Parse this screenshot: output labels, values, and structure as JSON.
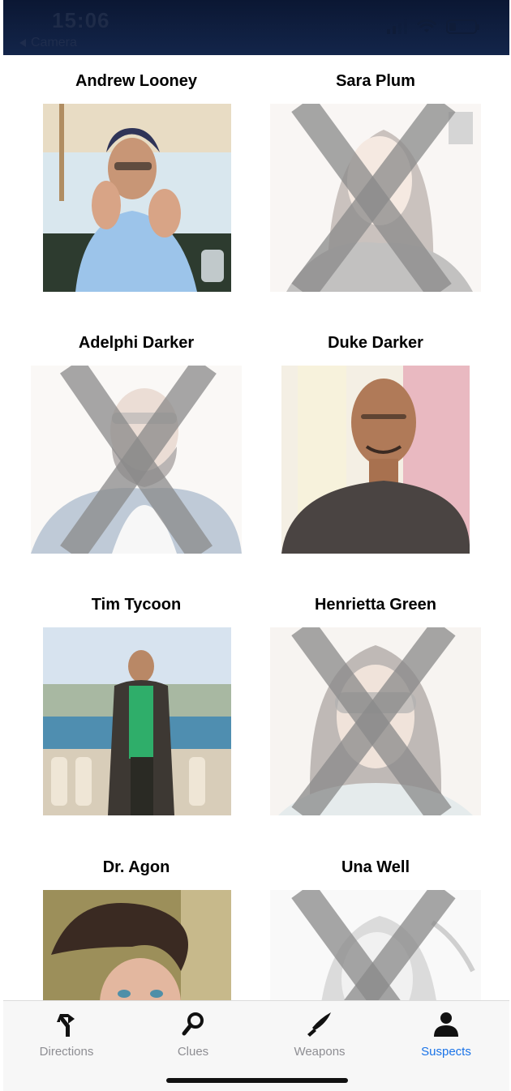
{
  "status_bar": {
    "time": "15:06",
    "back_label": "Camera",
    "battery_level": 0.25
  },
  "suspects": [
    {
      "name": "Andrew Looney",
      "eliminated": false
    },
    {
      "name": "Sara Plum",
      "eliminated": true
    },
    {
      "name": "Adelphi Darker",
      "eliminated": true
    },
    {
      "name": "Duke Darker",
      "eliminated": false
    },
    {
      "name": "Tim Tycoon",
      "eliminated": false
    },
    {
      "name": "Henrietta Green",
      "eliminated": true
    },
    {
      "name": "Dr. Agon",
      "eliminated": false
    },
    {
      "name": "Una Well",
      "eliminated": true
    }
  ],
  "tabs": [
    {
      "label": "Directions",
      "icon": "directions-icon",
      "active": false
    },
    {
      "label": "Clues",
      "icon": "magnifier-icon",
      "active": false
    },
    {
      "label": "Weapons",
      "icon": "knife-icon",
      "active": false
    },
    {
      "label": "Suspects",
      "icon": "person-icon",
      "active": true
    }
  ],
  "colors": {
    "accent": "#1a73e8",
    "inactive_tab": "#8e8e93",
    "cross_mark": "#8a8a8a",
    "status_bar_bg": "#0b1733"
  }
}
